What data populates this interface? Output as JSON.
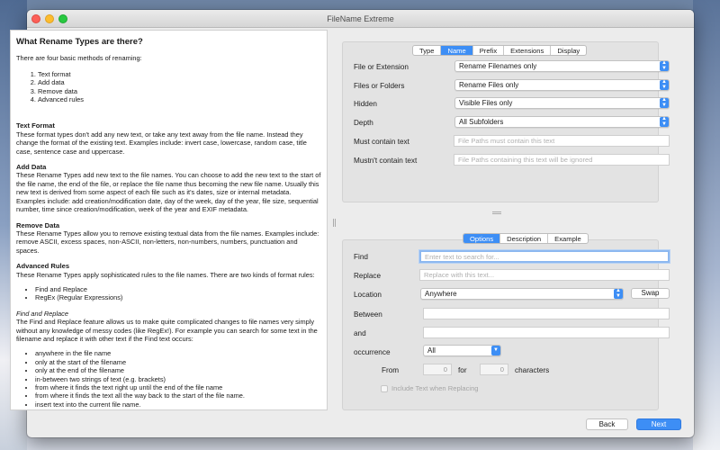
{
  "app": {
    "title": "FileName Extreme"
  },
  "doc": {
    "title": "What Rename Types are there?",
    "intro": "There are four basic methods of renaming:",
    "methods": [
      "Text format",
      "Add data",
      "Remove data",
      "Advanced rules"
    ],
    "sections": [
      {
        "heading": "Text Format",
        "body": "These format types don't add any new text, or take any text away from the file name. Instead they change the format of the existing text. Examples include: invert case, lowercase, random case, title case, sentence case and uppercase."
      },
      {
        "heading": "Add Data",
        "body": "These Rename Types add new text to the file names. You can choose to add the new text to the start of the file name, the end of the file, or replace the file name thus becoming the new file name. Usually this new text is derived from some aspect of each file such as it's dates, size or internal metadata. Examples include: add creation/modification date, day of the week, day of the year, file size, sequential number, time since creation/modification, week of the year and EXIF metadata."
      },
      {
        "heading": "Remove Data",
        "body": "These Rename Types allow you to remove existing textual data from the file names. Examples include: remove ASCII, excess spaces, non-ASCII, non-letters, non-numbers, numbers, punctuation and spaces."
      },
      {
        "heading": "Advanced Rules",
        "body": "These Rename Types apply sophisticated rules to the file names. There are two kinds of format rules:"
      }
    ],
    "rule_kinds": [
      "Find and Replace",
      "RegEx (Regular Expressions)"
    ],
    "find_replace_heading": "Find and Replace",
    "find_replace_body": "The Find and Replace feature allows us to make quite complicated changes to file names very simply without any knowledge of messy codes (like RegEx!). For example you can search for some text in the filename and replace it with other text if the Find text occurs:",
    "find_positions": [
      "anywhere in the file name",
      "only at the start of the filename",
      "only at the end of the filename",
      "in-between two strings of text (e.g. brackets)",
      "from where it finds the text right up until the end of the file name",
      "from where it finds the text all the way back to the start of the file name.",
      "insert text into the current file name."
    ]
  },
  "top_tabs": [
    "Type",
    "Name",
    "Prefix",
    "Extensions",
    "Display"
  ],
  "top_active_tab": "Name",
  "name_panel": {
    "file_or_extension": {
      "label": "File or Extension",
      "value": "Rename Filenames only"
    },
    "files_or_folders": {
      "label": "Files or Folders",
      "value": "Rename Files only"
    },
    "hidden": {
      "label": "Hidden",
      "value": "Visible Files only"
    },
    "depth": {
      "label": "Depth",
      "value": "All Subfolders"
    },
    "must_contain": {
      "label": "Must contain text",
      "placeholder": "File Paths must contain this text"
    },
    "mustnt_contain": {
      "label": "Mustn't contain text",
      "placeholder": "File Paths containing this text will be ignored"
    }
  },
  "bottom_tabs": [
    "Options",
    "Description",
    "Example"
  ],
  "bottom_active_tab": "Options",
  "options_panel": {
    "find": {
      "label": "Find",
      "placeholder": "Enter text to search for..."
    },
    "replace": {
      "label": "Replace",
      "placeholder": "Replace with this text..."
    },
    "location": {
      "label": "Location",
      "value": "Anywhere"
    },
    "swap_label": "Swap",
    "between_label": "Between",
    "and_label": "and",
    "occurrence": {
      "label": "occurrence",
      "value": "All"
    },
    "from_label": "From",
    "from_value": "0",
    "for_label": "for",
    "for_value": "0",
    "characters_label": "characters",
    "include_text_label": "Include Text when Replacing"
  },
  "footer": {
    "back_label": "Back",
    "next_label": "Next"
  },
  "colors": {
    "accent": "#3d8ef5",
    "window_bg": "#ececec",
    "panel_bg": "#e3e3e3"
  }
}
